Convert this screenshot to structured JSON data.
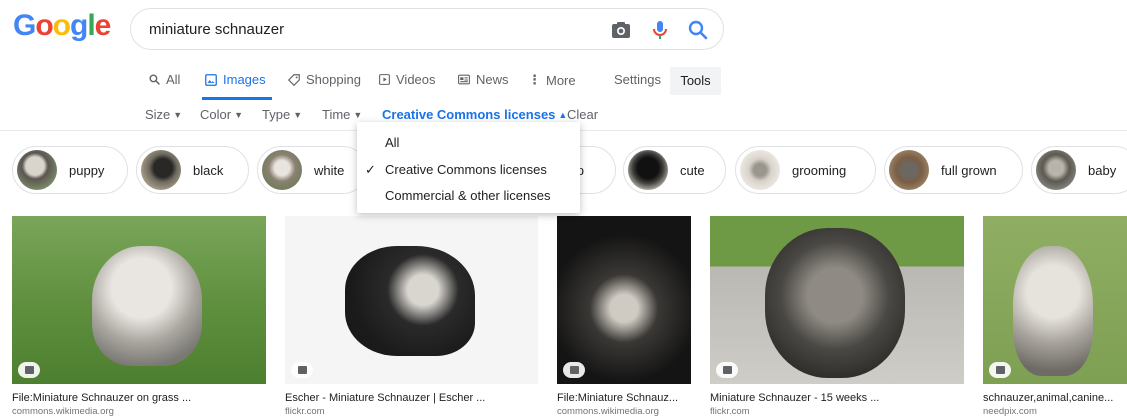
{
  "logo": {
    "letters": [
      "G",
      "o",
      "o",
      "g",
      "l",
      "e"
    ],
    "colors": [
      "#4285F4",
      "#EA4335",
      "#FBBC05",
      "#4285F4",
      "#34A853",
      "#EA4335"
    ]
  },
  "search": {
    "query": "miniature schnauzer"
  },
  "nav": {
    "all": "All",
    "images": "Images",
    "shopping": "Shopping",
    "videos": "Videos",
    "news": "News",
    "more": "More",
    "settings": "Settings",
    "tools": "Tools"
  },
  "filters": {
    "size": "Size",
    "color": "Color",
    "type": "Type",
    "time": "Time",
    "license": "Creative Commons licenses",
    "clear": "Clear"
  },
  "license_dropdown": {
    "options": [
      "All",
      "Creative Commons licenses",
      "Commercial & other licenses"
    ],
    "selected": "Creative Commons licenses"
  },
  "chips": [
    "puppy",
    "black",
    "white",
    "cup",
    "cute",
    "grooming",
    "full grown",
    "baby"
  ],
  "results": [
    {
      "title": "File:Miniature Schnauzer on grass ...",
      "source": "commons.wikimedia.org"
    },
    {
      "title": "Escher - Miniature Schnauzer | Escher ...",
      "source": "flickr.com"
    },
    {
      "title": "File:Miniature Schnauz...",
      "source": "commons.wikimedia.org"
    },
    {
      "title": "Miniature Schnauzer - 15 weeks ...",
      "source": "flickr.com"
    },
    {
      "title": "schnauzer,animal,canine...",
      "source": "needpix.com"
    }
  ],
  "colors": {
    "accent": "#1a73e8",
    "text_secondary": "#5f6368",
    "border": "#dfe1e5"
  }
}
